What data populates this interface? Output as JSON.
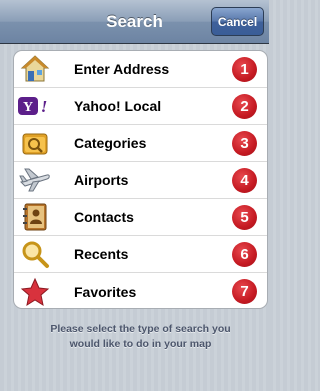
{
  "navbar": {
    "title": "Search",
    "cancel_label": "Cancel"
  },
  "items": [
    {
      "label": "Enter Address",
      "badge": "1",
      "icon": "house-icon"
    },
    {
      "label": "Yahoo! Local",
      "badge": "2",
      "icon": "yahoo-logo-icon"
    },
    {
      "label": "Categories",
      "badge": "3",
      "icon": "categories-folder-icon"
    },
    {
      "label": "Airports",
      "badge": "4",
      "icon": "airplane-icon"
    },
    {
      "label": "Contacts",
      "badge": "5",
      "icon": "contacts-book-icon"
    },
    {
      "label": "Recents",
      "badge": "6",
      "icon": "magnifier-icon"
    },
    {
      "label": "Favorites",
      "badge": "7",
      "icon": "star-icon"
    }
  ],
  "hint": {
    "line1": "Please select the type of search you",
    "line2": "would like to do in your map"
  },
  "colors": {
    "badge": "#c51a22",
    "nav": "#6d84a3",
    "background": "#c5ccd4"
  }
}
